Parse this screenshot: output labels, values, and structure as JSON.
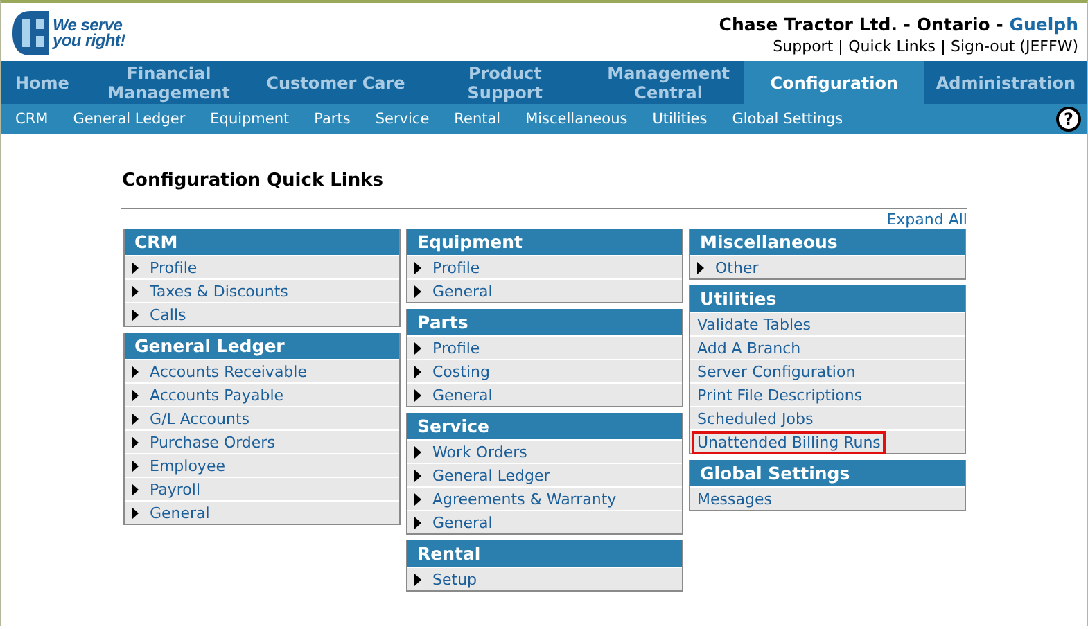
{
  "logo": {
    "tagline_1": "We serve",
    "tagline_2": "you right!"
  },
  "company": {
    "name": "Chase Tractor Ltd. - Ontario - ",
    "branch": "Guelph"
  },
  "top_links": [
    "Support",
    "Quick Links",
    "Sign-out (JEFFW)"
  ],
  "main_nav": [
    {
      "label": "Home",
      "selected": false
    },
    {
      "label": "Financial Management",
      "selected": false
    },
    {
      "label": "Customer Care",
      "selected": false
    },
    {
      "label": "Product Support",
      "selected": false
    },
    {
      "label": "Management Central",
      "selected": false
    },
    {
      "label": "Configuration",
      "selected": true
    },
    {
      "label": "Administration",
      "selected": false
    }
  ],
  "sub_nav": [
    "CRM",
    "General Ledger",
    "Equipment",
    "Parts",
    "Service",
    "Rental",
    "Miscellaneous",
    "Utilities",
    "Global Settings"
  ],
  "help": "?",
  "page_title": "Configuration Quick Links",
  "expand_all": "Expand All",
  "columns": [
    [
      {
        "title": "CRM",
        "items": [
          {
            "label": "Profile",
            "kind": "expander",
            "highlighted": false
          },
          {
            "label": "Taxes & Discounts",
            "kind": "expander",
            "highlighted": false
          },
          {
            "label": "Calls",
            "kind": "expander",
            "highlighted": false
          }
        ]
      },
      {
        "title": "General Ledger",
        "items": [
          {
            "label": "Accounts Receivable",
            "kind": "expander",
            "highlighted": false
          },
          {
            "label": "Accounts Payable",
            "kind": "expander",
            "highlighted": false
          },
          {
            "label": "G/L Accounts",
            "kind": "expander",
            "highlighted": false
          },
          {
            "label": "Purchase Orders",
            "kind": "expander",
            "highlighted": false
          },
          {
            "label": "Employee",
            "kind": "expander",
            "highlighted": false
          },
          {
            "label": "Payroll",
            "kind": "expander",
            "highlighted": false
          },
          {
            "label": "General",
            "kind": "expander",
            "highlighted": false
          }
        ]
      }
    ],
    [
      {
        "title": "Equipment",
        "items": [
          {
            "label": "Profile",
            "kind": "expander",
            "highlighted": false
          },
          {
            "label": "General",
            "kind": "expander",
            "highlighted": false
          }
        ]
      },
      {
        "title": "Parts",
        "items": [
          {
            "label": "Profile",
            "kind": "expander",
            "highlighted": false
          },
          {
            "label": "Costing",
            "kind": "expander",
            "highlighted": false
          },
          {
            "label": "General",
            "kind": "expander",
            "highlighted": false
          }
        ]
      },
      {
        "title": "Service",
        "items": [
          {
            "label": "Work Orders",
            "kind": "expander",
            "highlighted": false
          },
          {
            "label": "General Ledger",
            "kind": "expander",
            "highlighted": false
          },
          {
            "label": "Agreements & Warranty",
            "kind": "expander",
            "highlighted": false
          },
          {
            "label": "General",
            "kind": "expander",
            "highlighted": false
          }
        ]
      },
      {
        "title": "Rental",
        "items": [
          {
            "label": "Setup",
            "kind": "expander",
            "highlighted": false
          }
        ]
      }
    ],
    [
      {
        "title": "Miscellaneous",
        "items": [
          {
            "label": "Other",
            "kind": "expander",
            "highlighted": false
          }
        ]
      },
      {
        "title": "Utilities",
        "items": [
          {
            "label": "Validate Tables",
            "kind": "link",
            "highlighted": false
          },
          {
            "label": "Add A Branch",
            "kind": "link",
            "highlighted": false
          },
          {
            "label": "Server Configuration",
            "kind": "link",
            "highlighted": false
          },
          {
            "label": "Print File Descriptions",
            "kind": "link",
            "highlighted": false
          },
          {
            "label": "Scheduled Jobs",
            "kind": "link",
            "highlighted": false
          },
          {
            "label": "Unattended Billing Runs",
            "kind": "link",
            "highlighted": true
          }
        ]
      },
      {
        "title": "Global Settings",
        "items": [
          {
            "label": "Messages",
            "kind": "link",
            "highlighted": false
          }
        ]
      }
    ]
  ]
}
